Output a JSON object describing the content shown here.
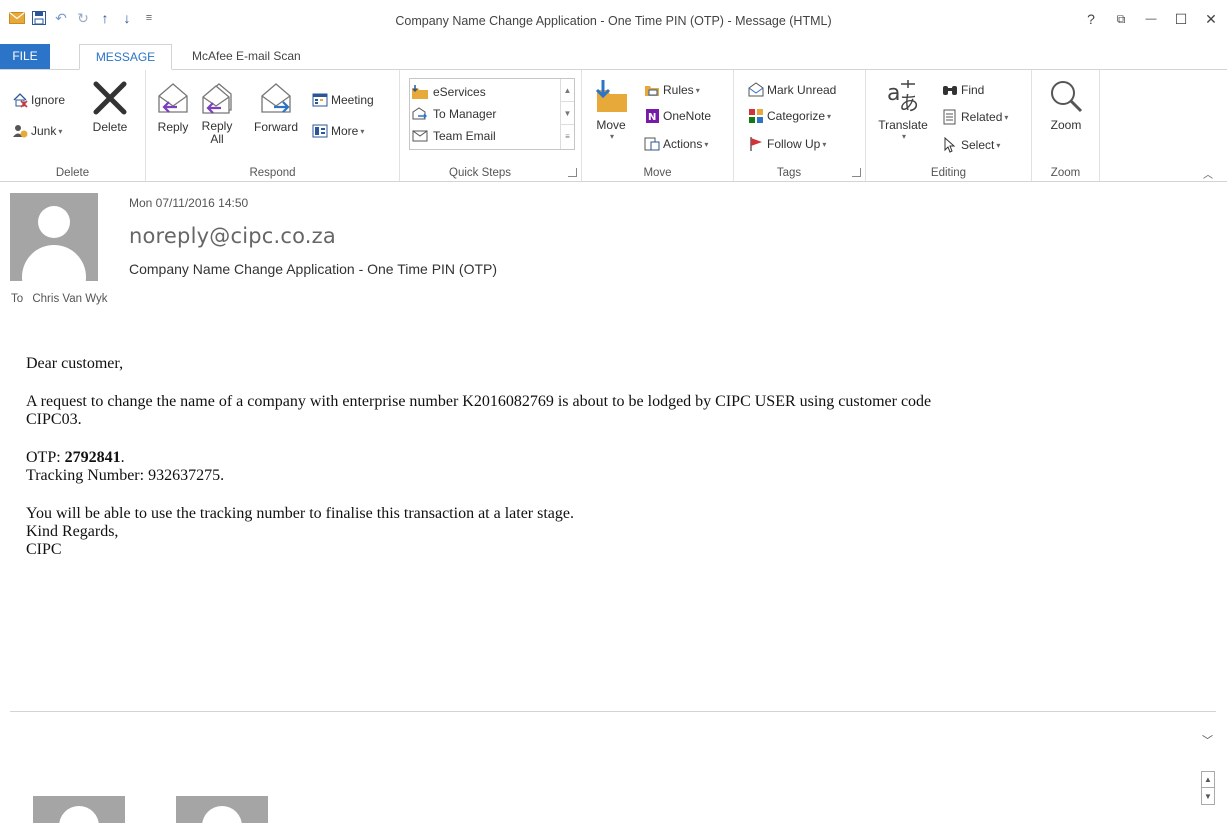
{
  "window": {
    "title": "Company Name Change Application - One Time PIN (OTP) - Message (HTML)",
    "help": "?",
    "restore_ribbon": "⧉",
    "minimize": "—",
    "maximize": "☐",
    "close": "✕"
  },
  "qat": {
    "mail_icon": "envelope-icon",
    "save_icon": "save-icon",
    "undo_icon": "undo-icon",
    "redo_icon": "redo-icon",
    "up_icon": "up-arrow-icon",
    "down_icon": "down-arrow-icon",
    "customize_icon": "customize-icon"
  },
  "tabs": {
    "file": "FILE",
    "message": "MESSAGE",
    "mcafee": "McAfee E-mail Scan"
  },
  "ribbon": {
    "delete_group": {
      "label": "Delete",
      "ignore": "Ignore",
      "junk": "Junk",
      "delete": "Delete"
    },
    "respond_group": {
      "label": "Respond",
      "reply": "Reply",
      "reply_all_line1": "Reply",
      "reply_all_line2": "All",
      "forward": "Forward",
      "meeting": "Meeting",
      "more": "More"
    },
    "quick_steps_group": {
      "label": "Quick Steps",
      "items": [
        "eServices",
        "To Manager",
        "Team Email"
      ]
    },
    "move_group": {
      "label": "Move",
      "move": "Move",
      "rules": "Rules",
      "onenote": "OneNote",
      "actions": "Actions"
    },
    "tags_group": {
      "label": "Tags",
      "mark_unread": "Mark Unread",
      "categorize": "Categorize",
      "follow_up": "Follow Up"
    },
    "editing_group": {
      "label": "Editing",
      "translate": "Translate",
      "find": "Find",
      "related": "Related",
      "select": "Select"
    },
    "zoom_group": {
      "label": "Zoom",
      "zoom": "Zoom"
    }
  },
  "message": {
    "date": "Mon 07/11/2016 14:50",
    "from": "noreply@cipc.co.za",
    "subject": "Company Name Change Application - One Time PIN (OTP)",
    "to_label": "To",
    "to_name": "Chris Van Wyk",
    "body": {
      "greeting": "Dear customer,",
      "request_line1": "A request to change the name of a company with enterprise number K2016082769 is about to be lodged by CIPC USER using customer code",
      "request_line2": "CIPC03.",
      "otp_label": "OTP: ",
      "otp_value": "2792841",
      "otp_end": ".",
      "tracking": "Tracking Number: 932637275.",
      "finalise": "You will be able to use the tracking number to finalise this transaction at a later stage.",
      "regards": "Kind Regards,",
      "signature": "CIPC"
    }
  },
  "colors": {
    "accent": "#2b74c7",
    "avatar_gray": "#a5a5a5"
  }
}
